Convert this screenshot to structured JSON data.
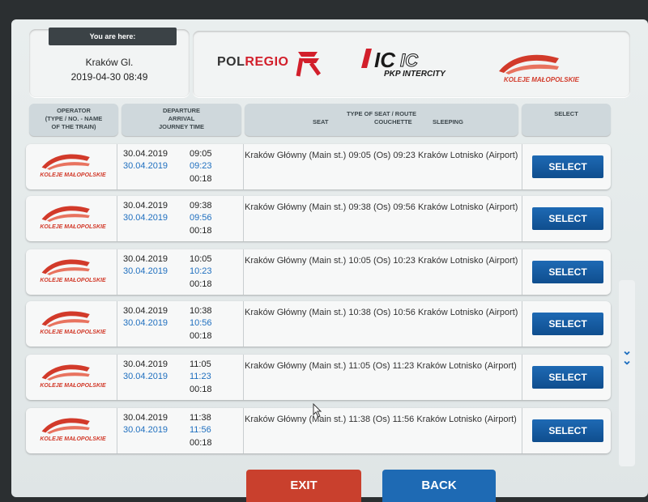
{
  "location": {
    "header": "You are here:",
    "station": "Kraków Gl.",
    "datetime": "2019-04-30 08:49"
  },
  "logos": {
    "polregio_a": "POL",
    "polregio_b": "REGIO",
    "intercity": "PKP INTERCITY",
    "koleje": "KOLEJE MAŁOPOLSKIE"
  },
  "headers": {
    "operator": [
      "OPERATOR",
      "(TYPE / NO. - NAME",
      "OF THE TRAIN)"
    ],
    "departure": [
      "DEPARTURE",
      "ARRIVAL",
      "JOURNEY TIME"
    ],
    "seat_route": "TYPE OF SEAT / ROUTE",
    "seat": "SEAT",
    "couchette": "COUCHETTE",
    "sleeping": "SLEEPING",
    "select": "SELECT"
  },
  "rows": [
    {
      "operator": "KOLEJE MAŁOPOLSKIE",
      "dep_date": "30.04.2019",
      "arr_date": "30.04.2019",
      "dep_time": "09:05",
      "arr_time": "09:23",
      "duration": "00:18",
      "route": "Kraków Główny (Main st.) 09:05 (Os) 09:23 Kraków Lotnisko (Airport)",
      "button": "SELECT"
    },
    {
      "operator": "KOLEJE MAŁOPOLSKIE",
      "dep_date": "30.04.2019",
      "arr_date": "30.04.2019",
      "dep_time": "09:38",
      "arr_time": "09:56",
      "duration": "00:18",
      "route": "Kraków Główny (Main st.) 09:38 (Os) 09:56 Kraków Lotnisko (Airport)",
      "button": "SELECT"
    },
    {
      "operator": "KOLEJE MAŁOPOLSKIE",
      "dep_date": "30.04.2019",
      "arr_date": "30.04.2019",
      "dep_time": "10:05",
      "arr_time": "10:23",
      "duration": "00:18",
      "route": "Kraków Główny (Main st.) 10:05 (Os) 10:23 Kraków Lotnisko (Airport)",
      "button": "SELECT"
    },
    {
      "operator": "KOLEJE MAŁOPOLSKIE",
      "dep_date": "30.04.2019",
      "arr_date": "30.04.2019",
      "dep_time": "10:38",
      "arr_time": "10:56",
      "duration": "00:18",
      "route": "Kraków Główny (Main st.) 10:38 (Os) 10:56 Kraków Lotnisko (Airport)",
      "button": "SELECT"
    },
    {
      "operator": "KOLEJE MAŁOPOLSKIE",
      "dep_date": "30.04.2019",
      "arr_date": "30.04.2019",
      "dep_time": "11:05",
      "arr_time": "11:23",
      "duration": "00:18",
      "route": "Kraków Główny (Main st.) 11:05 (Os) 11:23 Kraków Lotnisko (Airport)",
      "button": "SELECT"
    },
    {
      "operator": "KOLEJE MAŁOPOLSKIE",
      "dep_date": "30.04.2019",
      "arr_date": "30.04.2019",
      "dep_time": "11:38",
      "arr_time": "11:56",
      "duration": "00:18",
      "route": "Kraków Główny (Main st.) 11:38 (Os) 11:56 Kraków Lotnisko (Airport)",
      "button": "SELECT"
    }
  ],
  "bottom": {
    "exit": "EXIT",
    "back": "BACK"
  },
  "scroll_icon": "chevron-double-down-icon",
  "colors": {
    "select_blue": "#1e6ab4",
    "exit_red": "#c9402d",
    "arrival_blue": "#1f6fbf",
    "brand_red": "#d23a2a"
  }
}
